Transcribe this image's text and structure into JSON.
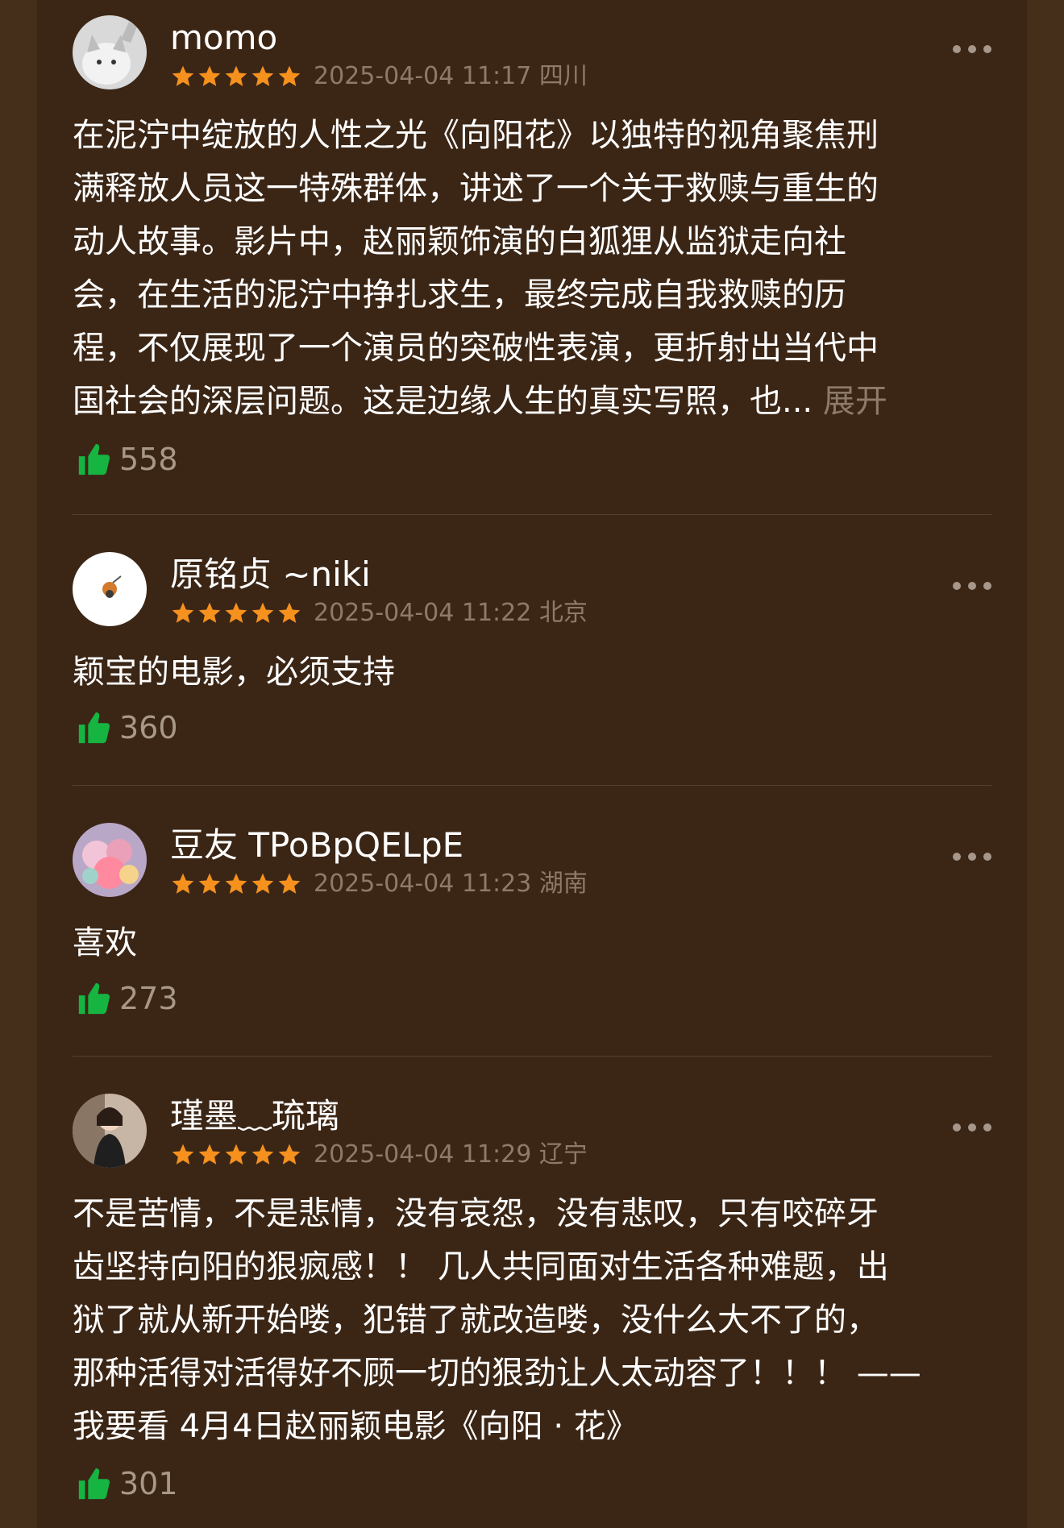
{
  "colors": {
    "background": "#3b2616",
    "star": "#f6911e",
    "thumb": "#16b441",
    "meta_text": "#8e7a69"
  },
  "reviews": [
    {
      "username": "momo",
      "rating": 5,
      "date": "2025-04-04 11:17 四川",
      "lines": [
        "在泥泞中绽放的人性之光《向阳花》以独特的视角聚焦刑",
        "满释放人员这一特殊群体，讲述了一个关于救赎与重生的",
        "动人故事。影片中，赵丽颖饰演的白狐狸从监狱走向社",
        "会，在生活的泥泞中挣扎求生，最终完成自我救赎的历",
        "程，不仅展现了一个演员的突破性表演，更折射出当代中",
        "国社会的深层问题。这是边缘人生的真实写照，也..."
      ],
      "expand_label": "展开",
      "likes": "558"
    },
    {
      "username": "原铭贞 ~niki",
      "rating": 5,
      "date": "2025-04-04 11:22 北京",
      "lines": [
        "颖宝的电影，必须支持"
      ],
      "likes": "360"
    },
    {
      "username": "豆友 TPoBpQELpE",
      "rating": 5,
      "date": "2025-04-04 11:23 湖南",
      "lines": [
        "喜欢"
      ],
      "likes": "273"
    },
    {
      "username": "瑾墨﹏琉璃",
      "rating": 5,
      "date": "2025-04-04 11:29 辽宁",
      "lines": [
        "不是苦情，不是悲情，没有哀怨，没有悲叹，只有咬碎牙",
        "齿坚持向阳的狠疯感！！ 几人共同面对生活各种难题，出",
        "狱了就从新开始喽，犯错了就改造喽，没什么大不了的，",
        "那种活得对活得好不顾一切的狠劲让人太动容了！！！ ——",
        "我要看 4月4日赵丽颖电影《向阳 · 花》"
      ],
      "likes": "301"
    }
  ]
}
